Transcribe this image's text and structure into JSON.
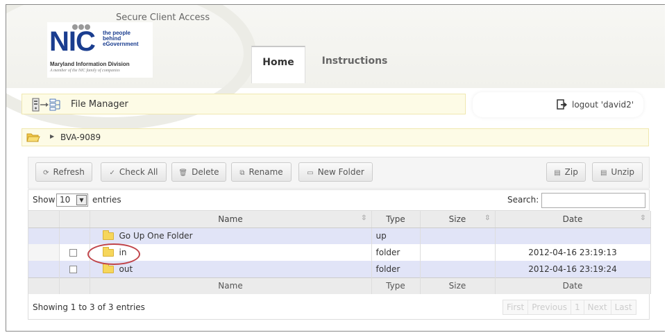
{
  "header": {
    "site_title": "Secure Client Access",
    "logo": {
      "brand": "NIC",
      "tagline": "the people\nbehind\neGovernment",
      "division": "Maryland Information Division",
      "subtitle": "A member of the NIC family of companies"
    },
    "tabs": [
      {
        "label": "Home",
        "active": true
      },
      {
        "label": "Instructions",
        "active": false
      }
    ]
  },
  "file_manager": {
    "title": "File Manager",
    "icon": "file-manager-icon"
  },
  "logout": {
    "label": "logout 'david2'",
    "icon": "logout-icon"
  },
  "breadcrumb": {
    "path": "BVA-9089",
    "icon": "open-folder-icon"
  },
  "toolbar": {
    "refresh": "Refresh",
    "check_all": "Check All",
    "delete": "Delete",
    "rename": "Rename",
    "new_folder": "New Folder",
    "zip": "Zip",
    "unzip": "Unzip"
  },
  "table": {
    "show_label": "Show",
    "show_value": "10",
    "entries_label": "entries",
    "search_label": "Search:",
    "search_value": "",
    "columns": [
      "",
      "Name",
      "Type",
      "Size",
      "Date"
    ],
    "rows": [
      {
        "checkbox": false,
        "name": "Go Up One Folder",
        "type": "up",
        "size": "",
        "date": ""
      },
      {
        "checkbox": true,
        "name": "in",
        "type": "folder",
        "size": "",
        "date": "2012-04-16 23:19:13"
      },
      {
        "checkbox": true,
        "name": "out",
        "type": "folder",
        "size": "",
        "date": "2012-04-16 23:19:24"
      }
    ],
    "info": "Showing 1 to 3 of 3 entries",
    "pager": {
      "first": "First",
      "previous": "Previous",
      "page": "1",
      "next": "Next",
      "last": "Last"
    }
  },
  "colors": {
    "accent_blue": "#1a3d8f",
    "highlight_yellow": "#fdfbe6",
    "row_odd": "#e1e4f7",
    "annotation_circle": "#c0444a"
  }
}
